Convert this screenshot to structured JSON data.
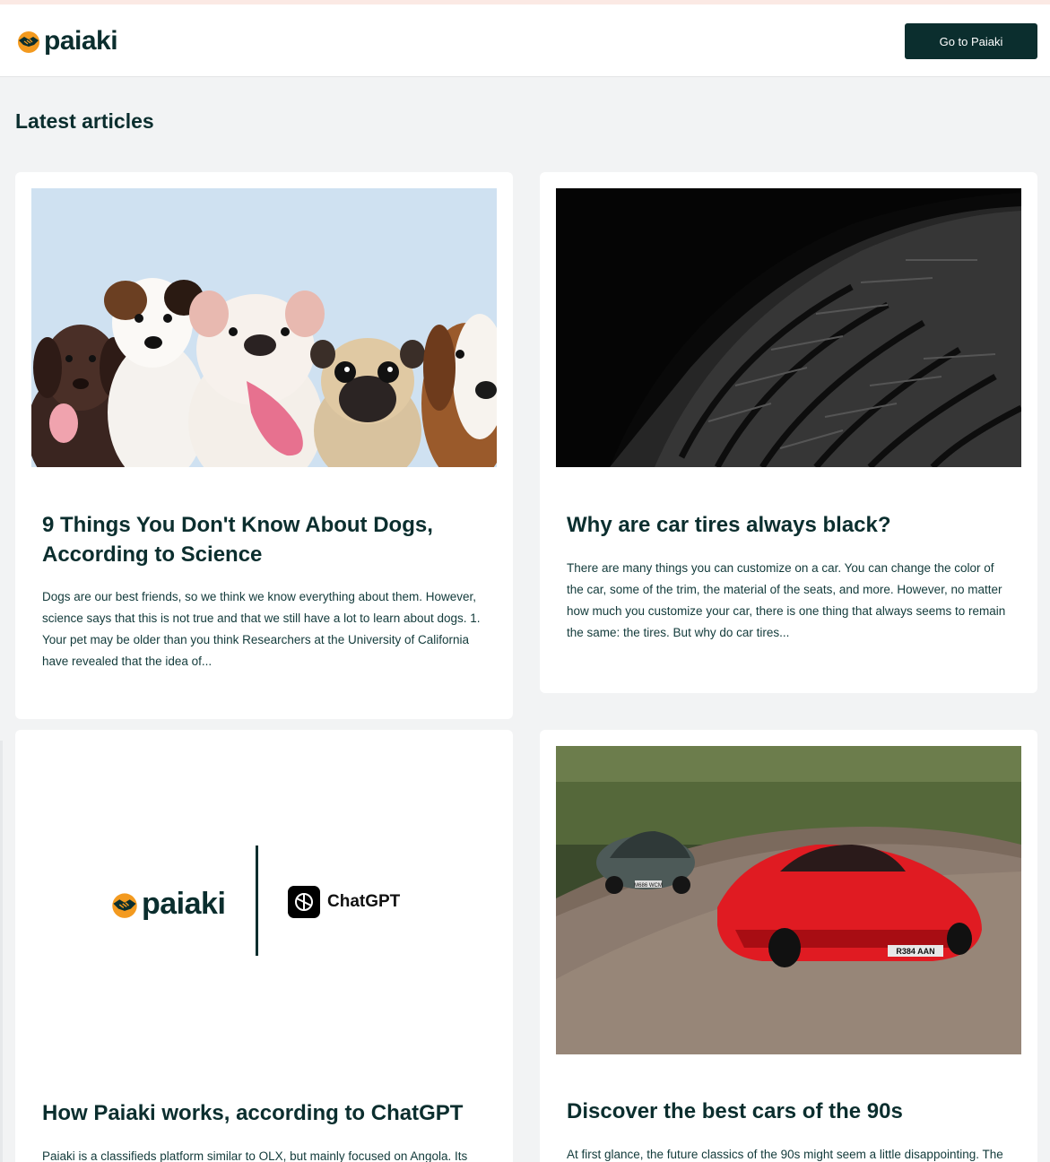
{
  "brand": {
    "name": "paiaki",
    "colors": {
      "primary": "#0b2e2e",
      "logo_orange": "#f39a1f",
      "background": "#f2f3f4"
    }
  },
  "header": {
    "cta_label": "Go to Paiaki"
  },
  "main": {
    "title": "Latest articles",
    "articles": [
      {
        "image": "puppies-photo",
        "title": "9 Things You Don't Know About Dogs, According to Science",
        "excerpt": "Dogs are our best friends, so we think we know everything about them. However, science says that this is not true and that we still have a lot to learn about dogs. 1. Your pet may be older than you think Researchers at the University of California have revealed that the idea of..."
      },
      {
        "image": "car-tire-photo",
        "title": "Why are car tires always black?",
        "excerpt": "There are many things you can customize on a car. You can change the color of the car, some of the trim, the material of the seats, and more. However, no matter how much you customize your car, there is one thing that always seems to remain the same: the tires. But why do car tires..."
      },
      {
        "image": "paiaki-chatgpt-logos",
        "image_brand_left": "paiaki",
        "image_brand_right": "ChatGPT",
        "title": "How Paiaki works, according to ChatGPT",
        "excerpt": "Paiaki is a classifieds platform similar to OLX, but mainly focused on Angola. Its"
      },
      {
        "image": "sports-cars-photo",
        "plates": [
          "M686 WCM",
          "R384 AAN"
        ],
        "title": "Discover the best cars of the 90s",
        "excerpt": "At first glance, the future classics of the 90s might seem a little disappointing. The"
      }
    ]
  }
}
